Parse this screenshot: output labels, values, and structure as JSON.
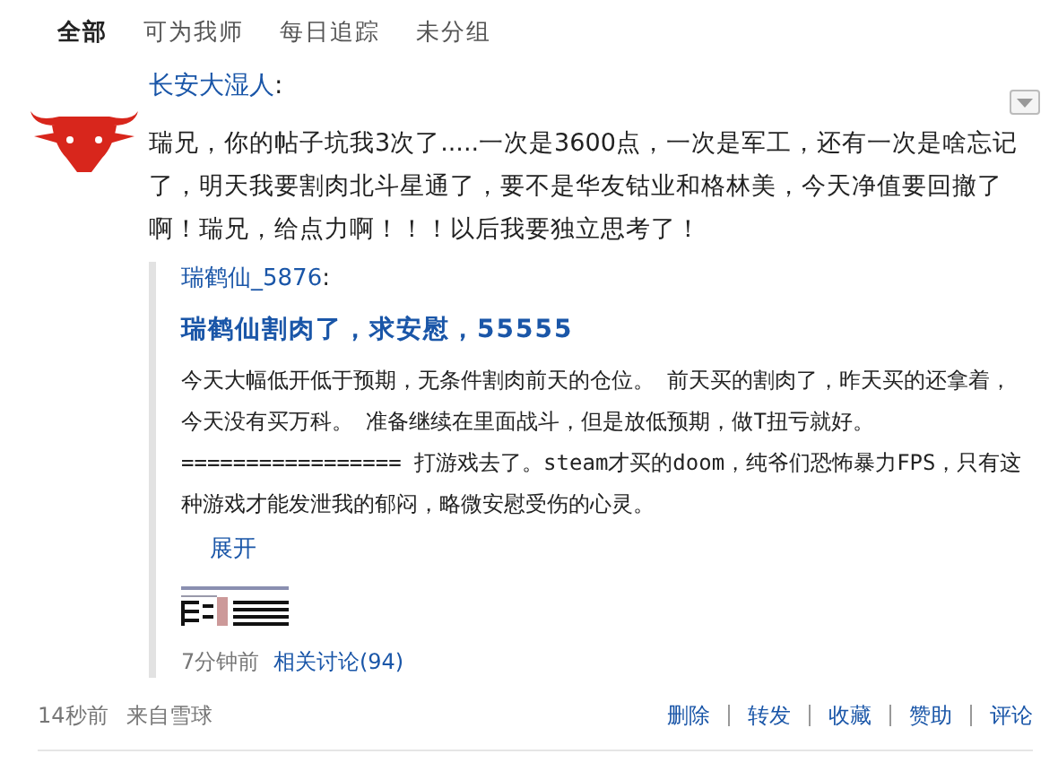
{
  "tabs": [
    {
      "label": "全部",
      "selected": true
    },
    {
      "label": "可为我师",
      "selected": false
    },
    {
      "label": "每日追踪",
      "selected": false
    },
    {
      "label": "未分组",
      "selected": false
    }
  ],
  "post": {
    "author": "长安大湿人",
    "colon": ":",
    "text": "瑞兄，你的帖子坑我3次了.....一次是3600点，一次是军工，还有一次是啥忘记了，明天我要割肉北斗星通了，要不是华友钴业和格林美，今天净值要回撤了啊！瑞兄，给点力啊！！！以后我要独立思考了！",
    "quote": {
      "author": "瑞鹤仙_5876",
      "colon": ":",
      "title": "瑞鹤仙割肉了，求安慰，55555",
      "text": "今天大幅低开低于预期，无条件割肉前天的仓位。 前天买的割肉了，昨天买的还拿着，今天没有买万科。 准备继续在里面战斗，但是放低预期，做T扭亏就好。 ================= 打游戏去了。steam才买的doom，纯爷们恐怖暴力FPS，只有这种游戏才能发泄我的郁闷，略微安慰受伤的心灵。",
      "expand": "展开",
      "time": "7分钟前",
      "related": "相关讨论(94)"
    },
    "time": "14秒前",
    "source": "来自雪球",
    "actions": [
      "删除",
      "转发",
      "收藏",
      "赞助",
      "评论"
    ]
  }
}
